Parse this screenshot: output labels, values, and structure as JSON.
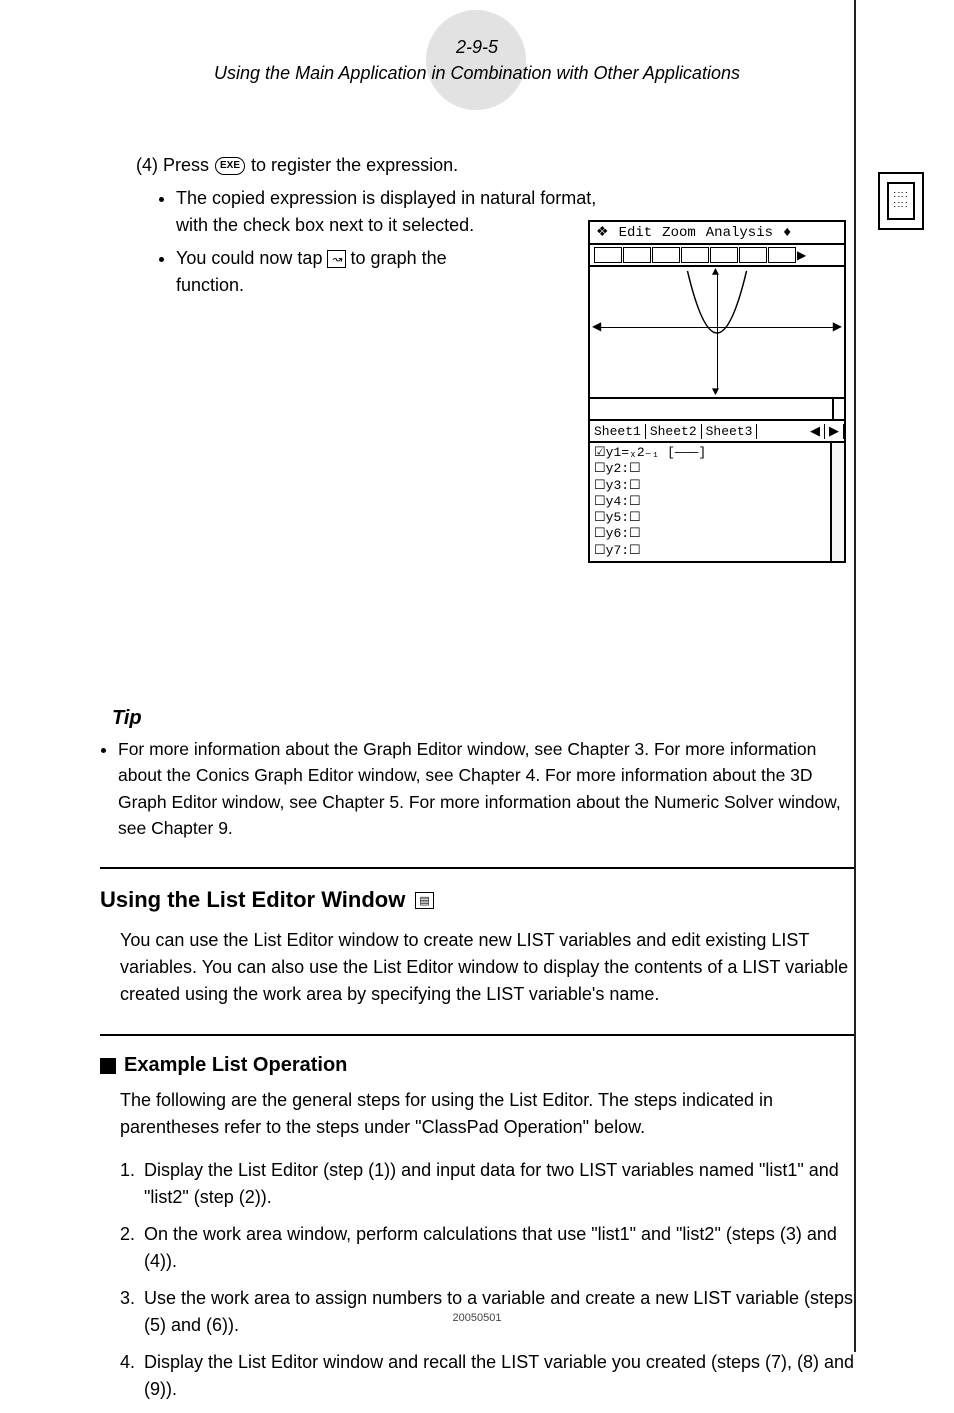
{
  "header": {
    "page_ref": "2-9-5",
    "title": "Using the Main Application in Combination with Other Applications"
  },
  "step4": {
    "label_before": "(4) Press",
    "button": "EXE",
    "label_after": "to register the expression."
  },
  "bullets": {
    "b1": "The copied expression is displayed in natural format, with the check box next to it selected.",
    "b2_before": "You could now tap",
    "b2_btn": "↝",
    "b2_after": "to graph the function."
  },
  "screenshot": {
    "menu": {
      "m1": "Edit",
      "m2": "Zoom",
      "m3": "Analysis"
    },
    "tabs": {
      "t1": "Sheet1",
      "t2": "Sheet2",
      "t3": "Sheet3",
      "left": "◀",
      "right": "▶"
    },
    "list": {
      "y1": "☑y1=ₓ2₋₁            [———]",
      "y2": "☐y2:☐",
      "y3": "☐y3:☐",
      "y4": "☐y4:☐",
      "y5": "☐y5:☐",
      "y6": "☐y6:☐",
      "y7": "☐y7:☐"
    }
  },
  "tip": {
    "heading": "Tip",
    "text": "For more information about the Graph Editor window, see Chapter 3. For more information about the Conics Graph Editor window, see Chapter 4. For more information about the 3D Graph Editor window, see Chapter 5. For more information about the Numeric Solver window, see Chapter 9."
  },
  "section_list_editor": {
    "heading": "Using the List Editor Window",
    "icon_text": "▤",
    "para": "You can use the List Editor window to create new LIST variables and edit existing LIST variables. You can also use the List Editor window to display the contents of a LIST variable created using the work area by specifying the LIST variable's name."
  },
  "example": {
    "heading": "Example List Operation",
    "intro": "The following are the general steps for using the List Editor. The steps indicated in parentheses refer to the steps under \"ClassPad Operation\" below.",
    "items": {
      "i1": "Display the List Editor (step (1)) and input data for two LIST variables named \"list1\" and \"list2\" (step (2)).",
      "i2": "On the work area window, perform calculations that use \"list1\" and \"list2\" (steps (3) and (4)).",
      "i3": "Use the work area to assign numbers to a variable and create a new LIST variable (steps (5) and (6)).",
      "i4": "Display the List Editor window and recall the LIST variable you created  (steps (7), (8) and (9))."
    }
  },
  "footer": {
    "code": "20050501"
  }
}
